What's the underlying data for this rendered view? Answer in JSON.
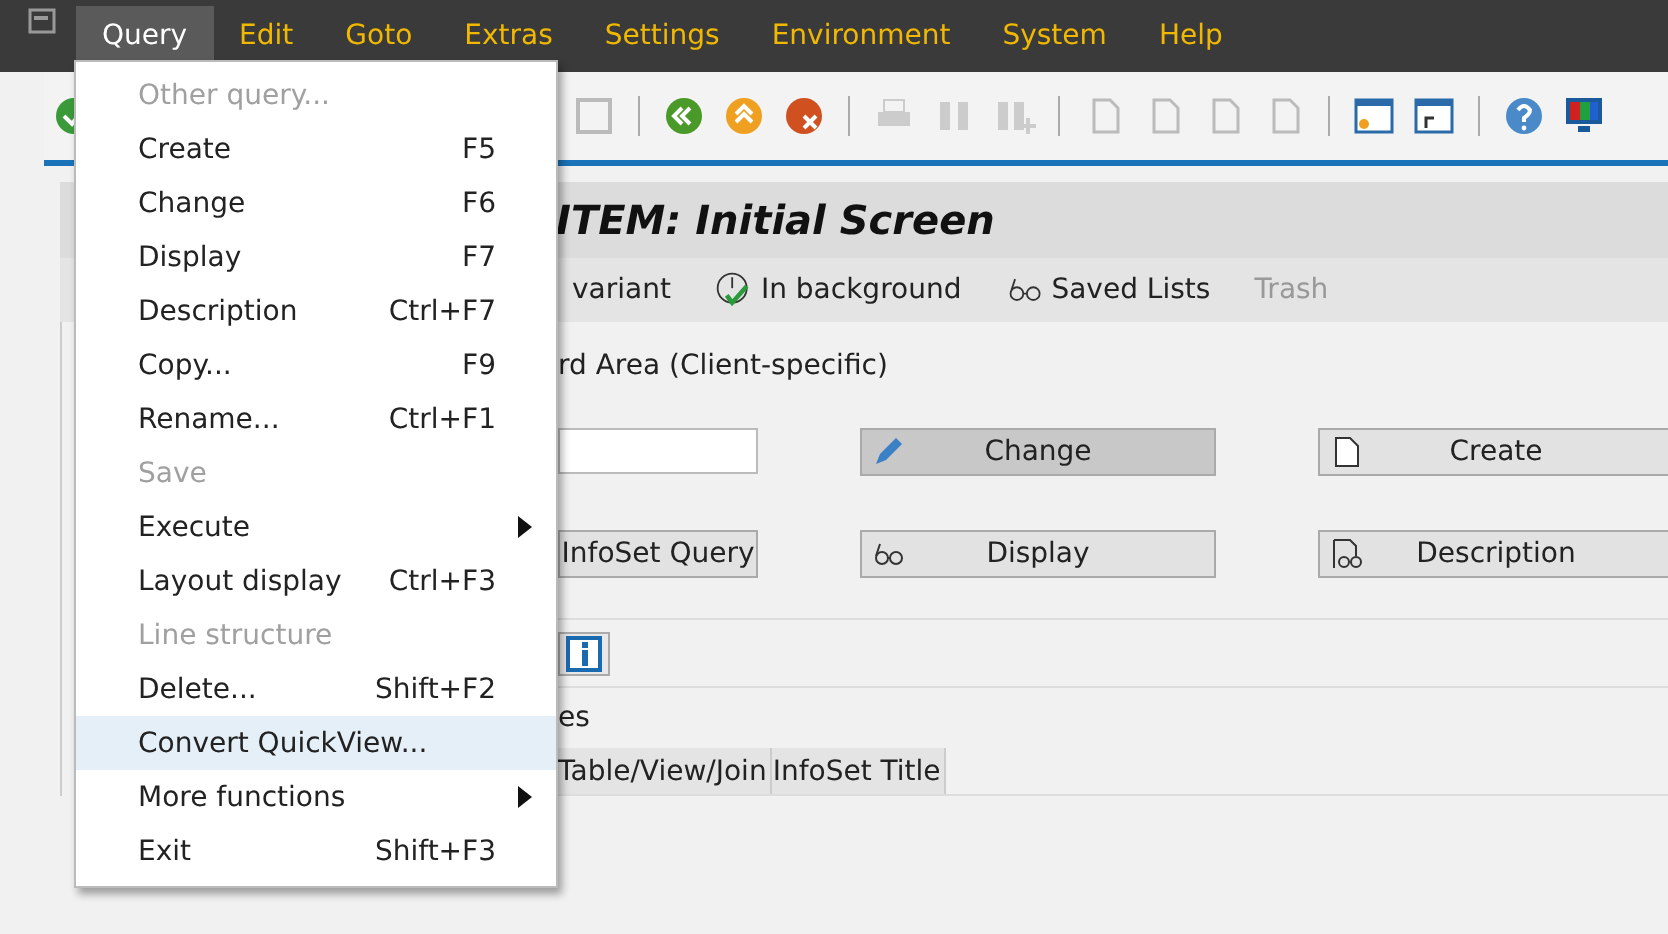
{
  "menubar": [
    {
      "label": "Query",
      "selected": true
    },
    {
      "label": "Edit",
      "selected": false
    },
    {
      "label": "Goto",
      "selected": false
    },
    {
      "label": "Extras",
      "selected": false
    },
    {
      "label": "Settings",
      "selected": false
    },
    {
      "label": "Environment",
      "selected": false
    },
    {
      "label": "System",
      "selected": false
    },
    {
      "label": "Help",
      "selected": false
    }
  ],
  "title": "ITEM: Initial Screen",
  "app_toolbar": [
    {
      "label": "variant",
      "kind": "text",
      "disabled": false
    },
    {
      "label": "In background",
      "kind": "clock",
      "disabled": false
    },
    {
      "label": "Saved Lists",
      "kind": "glasses",
      "disabled": false
    },
    {
      "label": "Trash",
      "kind": "text",
      "disabled": true
    }
  ],
  "work_area": "rd Area (Client-specific)",
  "buttons": [
    {
      "label": "Change",
      "kind": "pencil",
      "selected": true
    },
    {
      "label": "Create",
      "kind": "page",
      "selected": false
    },
    {
      "label": "InfoSet Query",
      "kind": "plain",
      "selected": false
    },
    {
      "label": "Display",
      "kind": "glasses",
      "selected": false
    },
    {
      "label": "Description",
      "kind": "doc",
      "selected": false
    }
  ],
  "list_title": "es",
  "table": {
    "columns": [
      "Table/View/Join",
      "InfoSet Title"
    ]
  },
  "menu": [
    {
      "label": "Other query...",
      "disabled": true,
      "selected": false,
      "kind": "item"
    },
    {
      "label": "Create",
      "shortcut": "F5",
      "disabled": false,
      "selected": false,
      "kind": "item"
    },
    {
      "label": "Change",
      "shortcut": "F6",
      "disabled": false,
      "selected": false,
      "kind": "item"
    },
    {
      "label": "Display",
      "shortcut": "F7",
      "disabled": false,
      "selected": false,
      "kind": "item"
    },
    {
      "label": "Description",
      "shortcut": "Ctrl+F7",
      "disabled": false,
      "selected": false,
      "kind": "item"
    },
    {
      "label": "Copy...",
      "shortcut": "F9",
      "disabled": false,
      "selected": false,
      "kind": "item"
    },
    {
      "label": "Rename...",
      "shortcut": "Ctrl+F1",
      "disabled": false,
      "selected": false,
      "kind": "item"
    },
    {
      "label": "Save",
      "disabled": true,
      "selected": false,
      "kind": "item"
    },
    {
      "label": "Execute",
      "disabled": false,
      "selected": false,
      "kind": "submenu"
    },
    {
      "label": "Layout display",
      "shortcut": "Ctrl+F3",
      "disabled": false,
      "selected": false,
      "kind": "item"
    },
    {
      "label": "Line structure",
      "disabled": true,
      "selected": false,
      "kind": "item"
    },
    {
      "label": "Delete...",
      "shortcut": "Shift+F2",
      "disabled": false,
      "selected": false,
      "kind": "item"
    },
    {
      "label": "Convert QuickView...",
      "disabled": false,
      "selected": true,
      "kind": "item"
    },
    {
      "label": "More functions",
      "disabled": false,
      "selected": false,
      "kind": "submenu"
    },
    {
      "label": "Exit",
      "shortcut": "Shift+F3",
      "disabled": false,
      "selected": false,
      "kind": "item"
    }
  ]
}
